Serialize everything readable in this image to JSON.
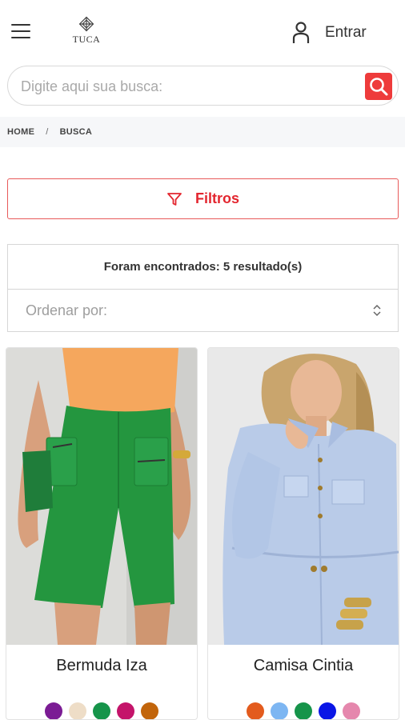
{
  "header": {
    "menu_icon": "hamburger-menu-icon",
    "logo_text": "TUCA",
    "login_label": "Entrar",
    "login_icon": "user-icon"
  },
  "search": {
    "placeholder": "Digite aqui sua busca:",
    "value": "",
    "icon": "search-icon",
    "accent_color": "#ee3b3b"
  },
  "breadcrumb": {
    "items": [
      "HOME",
      "BUSCA"
    ],
    "separator": "/"
  },
  "filters": {
    "label": "Filtros",
    "icon": "filter-funnel-icon",
    "color": "#e3262f"
  },
  "results": {
    "count_text": "Foram encontrados: 5 resultado(s)",
    "sort_placeholder": "Ordenar por:",
    "sort_icon": "updown-chevron-icon"
  },
  "products": [
    {
      "name": "Bermuda Iza",
      "colors": [
        "#7b1c94",
        "#eeddc7",
        "#16944a",
        "#c4146a",
        "#c2650b"
      ]
    },
    {
      "name": "Camisa Cintia",
      "colors": [
        "#e35b1d",
        "#7db6f2",
        "#16944a",
        "#0a16e6",
        "#e587ad"
      ]
    }
  ]
}
